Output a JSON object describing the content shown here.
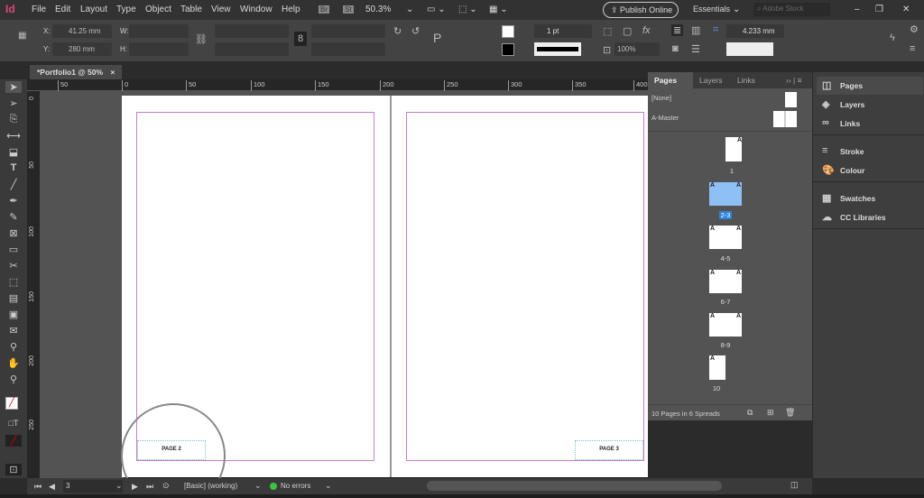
{
  "app": {
    "logo": "Id",
    "menus": [
      "File",
      "Edit",
      "Layout",
      "Type",
      "Object",
      "Table",
      "View",
      "Window",
      "Help"
    ],
    "bridge": "Br",
    "stock": "St",
    "zoom": "50.3%",
    "publish": "Publish Online",
    "workspace": "Essentials",
    "search_placeholder": "Adobe Stock"
  },
  "control": {
    "x_label": "X:",
    "x_value": "41.25 mm",
    "y_label": "Y:",
    "y_value": "280 mm",
    "w_label": "W:",
    "h_label": "H:",
    "stroke_weight": "1 pt",
    "opacity": "100%",
    "offset": "4.233 mm"
  },
  "document": {
    "tab": "*Portfolio1 @ 50%",
    "close": "×"
  },
  "ruler": {
    "top": [
      "50",
      "0",
      "50",
      "100",
      "150",
      "200",
      "250",
      "300",
      "350",
      "400"
    ],
    "left": [
      "0",
      "50",
      "100",
      "150",
      "200",
      "250"
    ]
  },
  "pages": [
    {
      "footer": "PAGE 2"
    },
    {
      "footer": "PAGE 3"
    }
  ],
  "pages_panel": {
    "tabs": [
      "Pages",
      "Layers",
      "Links"
    ],
    "none": "[None]",
    "master": "A-Master",
    "thumbs": [
      "1",
      "2-3",
      "4-5",
      "6-7",
      "8-9",
      "10"
    ],
    "prefix": "A",
    "summary": "10 Pages in 6 Spreads"
  },
  "dock": [
    "Pages",
    "Layers",
    "Links",
    "Stroke",
    "Colour",
    "Swatches",
    "CC Libraries"
  ],
  "status": {
    "page": "3",
    "profile": "[Basic] (working)",
    "errors": "No errors"
  }
}
